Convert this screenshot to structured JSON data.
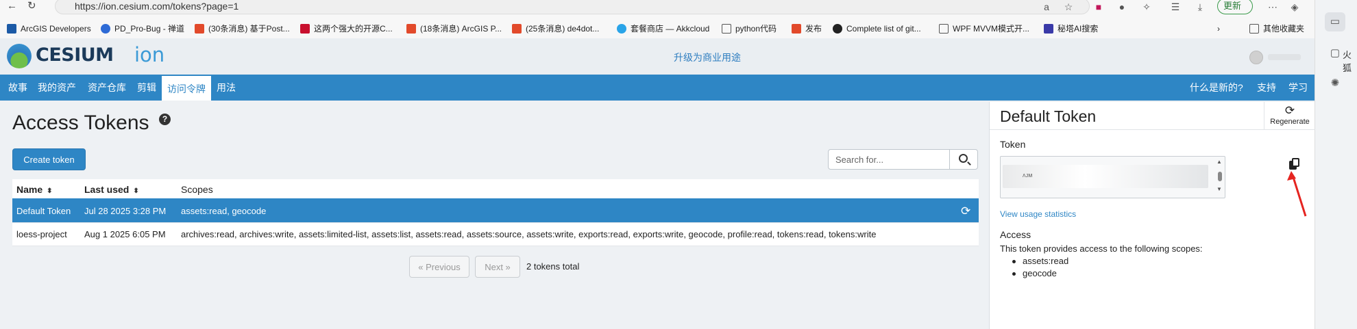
{
  "browser": {
    "url": "https://ion.cesium.com/tokens?page=1",
    "update_label": "更新",
    "bookmarks": [
      {
        "label": "ArcGIS Developers",
        "color": "#1c5aa6"
      },
      {
        "label": "PD_Pro-Bug - 禅道",
        "color": "#2e6bd6"
      },
      {
        "label": "(30条消息) 基于Post...",
        "color": "#e24a2b"
      },
      {
        "label": "这两个强大的开源C...",
        "color": "#c8102e"
      },
      {
        "label": "(18条消息) ArcGIS P...",
        "color": "#e24a2b"
      },
      {
        "label": "(25条消息) de4dot...",
        "color": "#e24a2b"
      },
      {
        "label": "套餐商店 — Akkcloud",
        "color": "#2aa4e8"
      },
      {
        "label": "python代码",
        "color": "#555555"
      },
      {
        "label": "发布",
        "color": "#e24a2b"
      },
      {
        "label": "Complete list of git...",
        "color": "#222222"
      },
      {
        "label": "WPF MVVM模式开...",
        "color": "#555555"
      },
      {
        "label": "秘塔AI搜索",
        "color": "#3a3aa8"
      },
      {
        "label": "其他收藏夹",
        "color": "#555555"
      }
    ],
    "side_label": "火狐"
  },
  "header": {
    "logo_text": "CESIUM",
    "logo_ion": "ion",
    "upgrade_link": "升级为商业用途"
  },
  "nav": {
    "left": [
      "故事",
      "我的资产",
      "资产仓库",
      "剪辑",
      "访问令牌",
      "用法"
    ],
    "active_index": 4,
    "right": [
      "什么是新的?",
      "支持",
      "学习"
    ]
  },
  "tokens_page": {
    "title": "Access Tokens",
    "help_glyph": "?",
    "create_button": "Create token",
    "search_placeholder": "Search for...",
    "columns": {
      "name": "Name",
      "last_used": "Last used",
      "scopes": "Scopes"
    },
    "rows": [
      {
        "name": "Default Token",
        "last_used": "Jul 28 2025 3:28 PM",
        "scopes": "assets:read, geocode",
        "selected": true
      },
      {
        "name": "loess-project",
        "last_used": "Aug 1 2025 6:05 PM",
        "scopes": "archives:read, archives:write, assets:limited-list, assets:list, assets:read, assets:source, assets:write, exports:read, exports:write, geocode, profile:read, tokens:read, tokens:write",
        "selected": false
      }
    ],
    "pager": {
      "previous": "« Previous",
      "next": "Next »",
      "total": "2 tokens total"
    }
  },
  "detail": {
    "title": "Default Token",
    "regenerate_label": "Regenerate",
    "token_label": "Token",
    "token_visible_fragment": "ᴧᴊᴍ",
    "usage_link": "View usage statistics",
    "access_label": "Access",
    "access_description": "This token provides access to the following scopes:",
    "scopes": [
      "assets:read",
      "geocode"
    ]
  },
  "colors": {
    "brand_blue": "#2e86c5",
    "annotation_red": "#e52420"
  }
}
